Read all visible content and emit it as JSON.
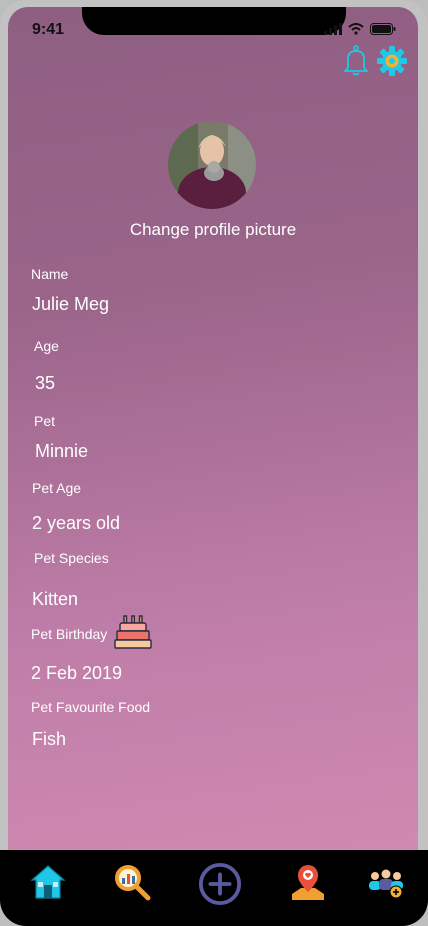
{
  "status": {
    "time": "9:41"
  },
  "profile": {
    "change_picture": "Change profile picture"
  },
  "fields": {
    "name_label": "Name",
    "name_value": "Julie Meg",
    "age_label": "Age",
    "age_value": "35",
    "pet_label": "Pet",
    "pet_value": "Minnie",
    "pet_age_label": "Pet Age",
    "pet_age_value": "2 years old",
    "pet_species_label": "Pet Species",
    "pet_species_value": "Kitten",
    "pet_birthday_label": "Pet Birthday",
    "pet_birthday_value": "2 Feb 2019",
    "pet_food_label": "Pet Favourite Food",
    "pet_food_value": "Fish"
  },
  "icons": {
    "bell": "bell-icon",
    "settings": "gear-icon",
    "cake": "birthday-cake-icon",
    "home": "home-icon",
    "search": "search-icon",
    "add": "add-icon",
    "map": "map-pin-icon",
    "community": "community-icon"
  },
  "colors": {
    "accent_cyan": "#1ec8e6",
    "nav_bg": "#000000",
    "add_button": "#5a5aa0",
    "search_orange": "#f0a030",
    "map_red": "#e8503a"
  }
}
